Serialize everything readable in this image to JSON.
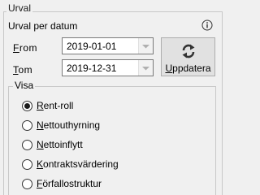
{
  "group": {
    "title": "Urval"
  },
  "section": {
    "title": "Urval per datum"
  },
  "info_icon": "info-circle-icon",
  "from": {
    "label_mnemonic": "F",
    "label_rest": "rom",
    "value": "2019-01-01"
  },
  "to": {
    "label_mnemonic": "T",
    "label_rest": "om",
    "value": "2019-12-31"
  },
  "update_button": {
    "mnemonic": "U",
    "rest": "ppdatera",
    "icon": "refresh-icon"
  },
  "visa": {
    "title": "Visa",
    "options": [
      {
        "mnemonic": "R",
        "rest": "ent-roll",
        "checked": true
      },
      {
        "mnemonic": "N",
        "rest": "ettouthyrning",
        "checked": false
      },
      {
        "mnemonic": "N",
        "rest": "ettoinflytt",
        "checked": false
      },
      {
        "mnemonic": "K",
        "rest": "ontraktsvärdering",
        "checked": false
      },
      {
        "mnemonic": "F",
        "rest": "örfallostruktur",
        "checked": false
      }
    ]
  }
}
